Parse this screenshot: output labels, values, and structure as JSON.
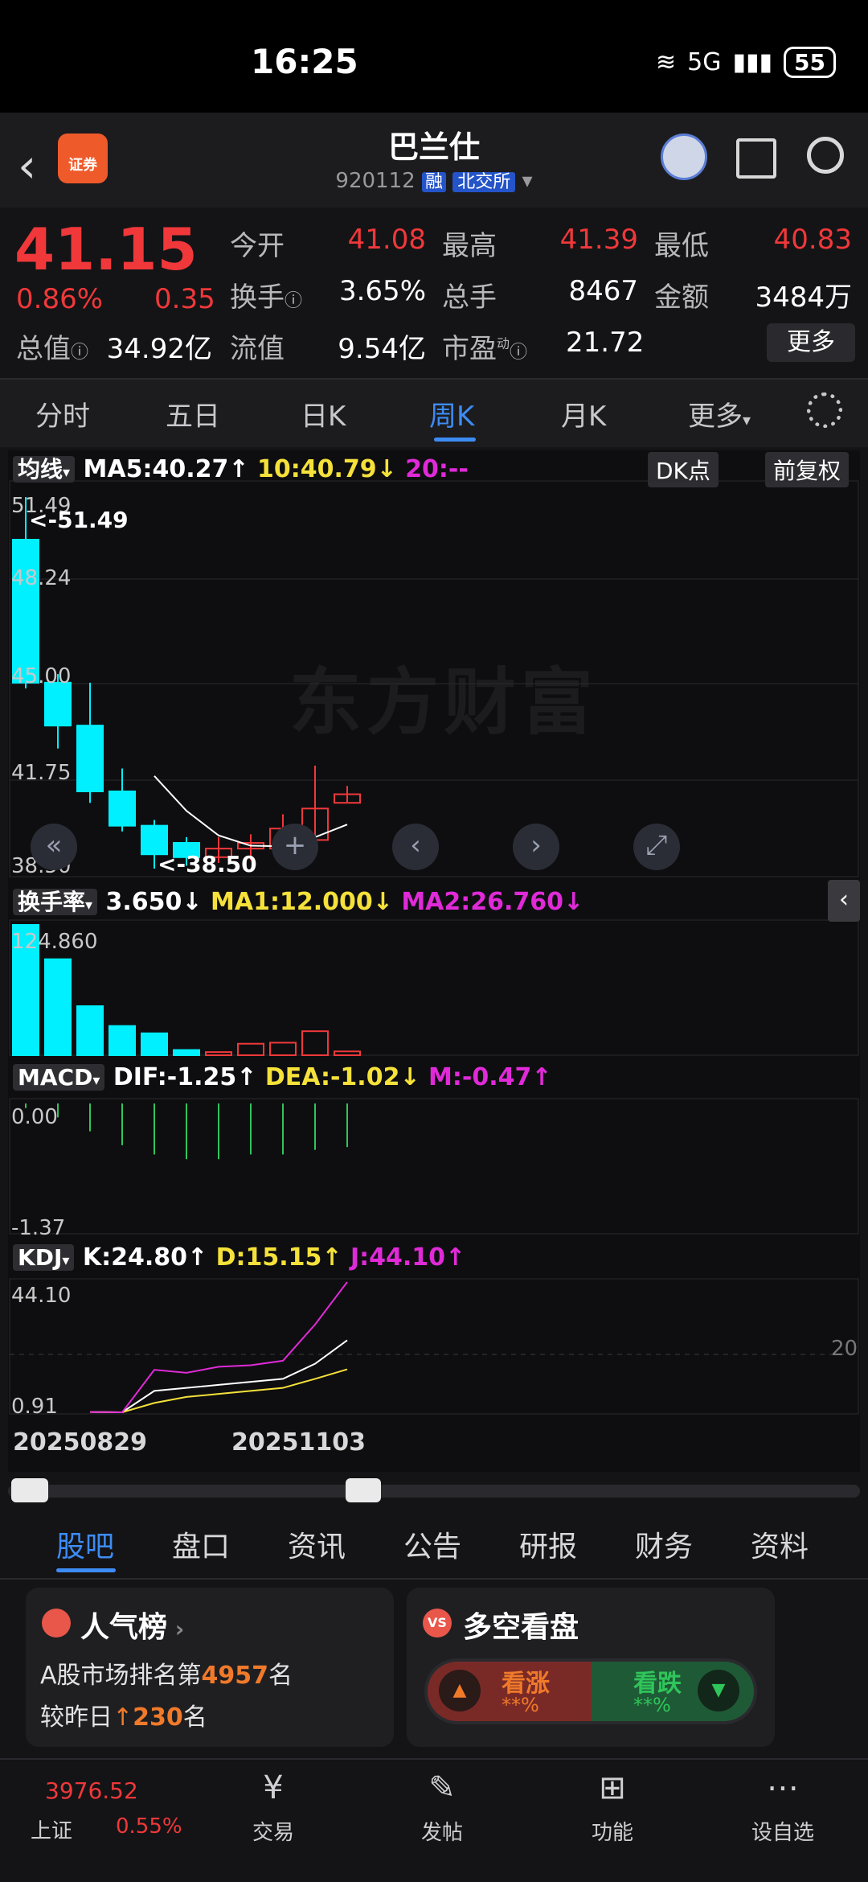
{
  "status": {
    "time": "16:25",
    "signal": "5G",
    "battery": "55"
  },
  "header": {
    "badge_label": "证券",
    "name": "巴兰仕",
    "code": "920112",
    "tag_margin": "融",
    "tag_exchange": "北交所"
  },
  "quote": {
    "price": "41.15",
    "pct": "0.86%",
    "change": "0.35",
    "open_label": "今开",
    "open": "41.08",
    "high_label": "最高",
    "high": "41.39",
    "low_label": "最低",
    "low": "40.83",
    "turnover_label": "换手",
    "turnover": "3.65%",
    "volume_label": "总手",
    "volume": "8467",
    "amount_label": "金额",
    "amount": "3484万",
    "mktcap_label": "总值",
    "mktcap": "34.92亿",
    "float_label": "流值",
    "float": "9.54亿",
    "pe_label": "市盈",
    "pe_sup": "动",
    "pe": "21.72",
    "more": "更多"
  },
  "tabs": [
    "分时",
    "五日",
    "日K",
    "周K",
    "月K",
    "更多"
  ],
  "active_tab": "周K",
  "chart": {
    "ma_selector": "均线",
    "ma5": "MA5:40.27↑",
    "ma10": "10:40.79↓",
    "ma20": "20:--",
    "dk": "DK点",
    "adjust": "前复权",
    "y_labels": [
      "51.49",
      "48.24",
      "45.00",
      "41.75",
      "38.50"
    ],
    "max_note": "<-51.49",
    "min_note": "<-38.50",
    "watermark": "东方财富",
    "turn_selector": "换手率",
    "turn_value": "3.650↓",
    "turn_ma1": "MA1:12.000↓",
    "turn_ma2": "MA2:26.760↓",
    "turn_max": "124.860",
    "macd_selector": "MACD",
    "dif": "DIF:-1.25↑",
    "dea": "DEA:-1.02↓",
    "m": "M:-0.47↑",
    "macd_top": "0.00",
    "macd_bottom": "-1.37",
    "kdj_selector": "KDJ",
    "k": "K:24.80↑",
    "d": "D:15.15↑",
    "j": "J:44.10↑",
    "kdj_top": "44.10",
    "kdj_bottom": "0.91",
    "kdj_ref": "20",
    "date_left": "20250829",
    "date_mid": "20251103"
  },
  "chart_data": {
    "type": "candlestick",
    "candles": [
      {
        "open": 50.0,
        "close": 45.0,
        "high": 51.49,
        "low": 44.8
      },
      {
        "open": 45.0,
        "close": 43.5,
        "high": 45.3,
        "low": 42.7
      },
      {
        "open": 43.5,
        "close": 41.2,
        "high": 45.0,
        "low": 40.8
      },
      {
        "open": 41.2,
        "close": 40.0,
        "high": 42.0,
        "low": 39.8
      },
      {
        "open": 40.0,
        "close": 39.0,
        "high": 40.2,
        "low": 38.5
      },
      {
        "open": 39.4,
        "close": 38.9,
        "high": 39.6,
        "low": 38.6
      },
      {
        "open": 38.9,
        "close": 39.2,
        "high": 39.6,
        "low": 38.7
      },
      {
        "open": 39.2,
        "close": 39.4,
        "high": 39.7,
        "low": 38.8
      },
      {
        "open": 39.2,
        "close": 39.9,
        "high": 40.4,
        "low": 38.9
      },
      {
        "open": 39.5,
        "close": 40.6,
        "high": 42.1,
        "low": 39.4
      },
      {
        "open": 40.8,
        "close": 41.1,
        "high": 41.39,
        "low": 40.83
      }
    ],
    "turnover": [
      124.86,
      92.0,
      47.0,
      28.0,
      21.0,
      5.0,
      3.0,
      11.0,
      12.0,
      23.0,
      3.65
    ],
    "macd_hist": [
      -0.05,
      -0.15,
      -0.3,
      -0.45,
      -0.55,
      -0.6,
      -0.6,
      -0.55,
      -0.55,
      -0.5,
      -0.47
    ],
    "kdj_k": [
      1.0,
      0.91,
      8.0,
      9.0,
      10.0,
      11.0,
      12.0,
      17.0,
      24.8
    ],
    "kdj_d": [
      1.0,
      0.91,
      4.0,
      6.0,
      7.0,
      8.0,
      9.0,
      12.0,
      15.15
    ],
    "kdj_j": [
      1.0,
      0.91,
      15.0,
      14.0,
      16.0,
      16.5,
      18.0,
      30.0,
      44.1
    ],
    "ylim_price": [
      38.5,
      51.49
    ],
    "ylim_turnover": [
      0,
      124.86
    ],
    "ylim_macd": [
      -1.37,
      0.0
    ],
    "ylim_kdj": [
      0.91,
      44.1
    ]
  },
  "bottom_tabs": [
    "股吧",
    "盘口",
    "资讯",
    "公告",
    "研报",
    "财务",
    "资料"
  ],
  "active_bottom_tab": "股吧",
  "popularity": {
    "title": "人气榜",
    "line1_prefix": "A股市场排名第",
    "rank": "4957",
    "line1_suffix": "名",
    "line2_prefix": "较昨日",
    "rank_change": "230",
    "line2_suffix": "名"
  },
  "long_short": {
    "badge": "VS",
    "title": "多空看盘",
    "up_label": "看涨",
    "up_pct": "**%",
    "down_label": "看跌",
    "down_pct": "**%"
  },
  "bottom_nav": {
    "index_value": "3976.52",
    "index_name": "上证",
    "index_pct": "0.55%",
    "trade": "交易",
    "post": "发帖",
    "func": "功能",
    "watchlist": "设自选"
  },
  "colors": {
    "up": "#f0383a",
    "down": "#2fc55a",
    "accent": "#3d8cf5",
    "candle_down": "#00f0ff"
  }
}
